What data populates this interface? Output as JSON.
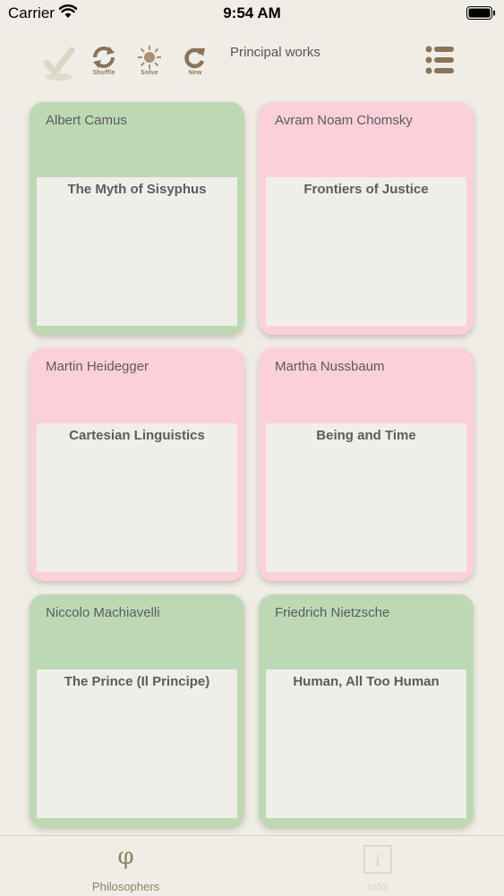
{
  "status_bar": {
    "carrier": "Carrier",
    "time": "9:54 AM"
  },
  "toolbar": {
    "shuffle_label": "Shuffle",
    "solve_label": "Solve",
    "new_label": "New",
    "title": "Principal works"
  },
  "cards": [
    {
      "name": "Albert Camus",
      "work": "The Myth of Sisyphus",
      "color": "green"
    },
    {
      "name": "Avram Noam Chomsky",
      "work": "Frontiers of Justice",
      "color": "pink"
    },
    {
      "name": "Martin Heidegger",
      "work": "Cartesian Linguistics",
      "color": "pink"
    },
    {
      "name": "Martha Nussbaum",
      "work": "Being and Time",
      "color": "pink"
    },
    {
      "name": "Niccolo Machiavelli",
      "work": "The Prince (Il Principe)",
      "color": "green"
    },
    {
      "name": "Friedrich Nietzsche",
      "work": "Human, All Too Human",
      "color": "green"
    }
  ],
  "colors": {
    "green": "#bcd9b4",
    "pink": "#fbd0da",
    "accent": "#8e8063"
  },
  "tab_bar": {
    "philosophers_icon": "φ",
    "philosophers_label": "Philosophers",
    "info_label": "Info"
  }
}
